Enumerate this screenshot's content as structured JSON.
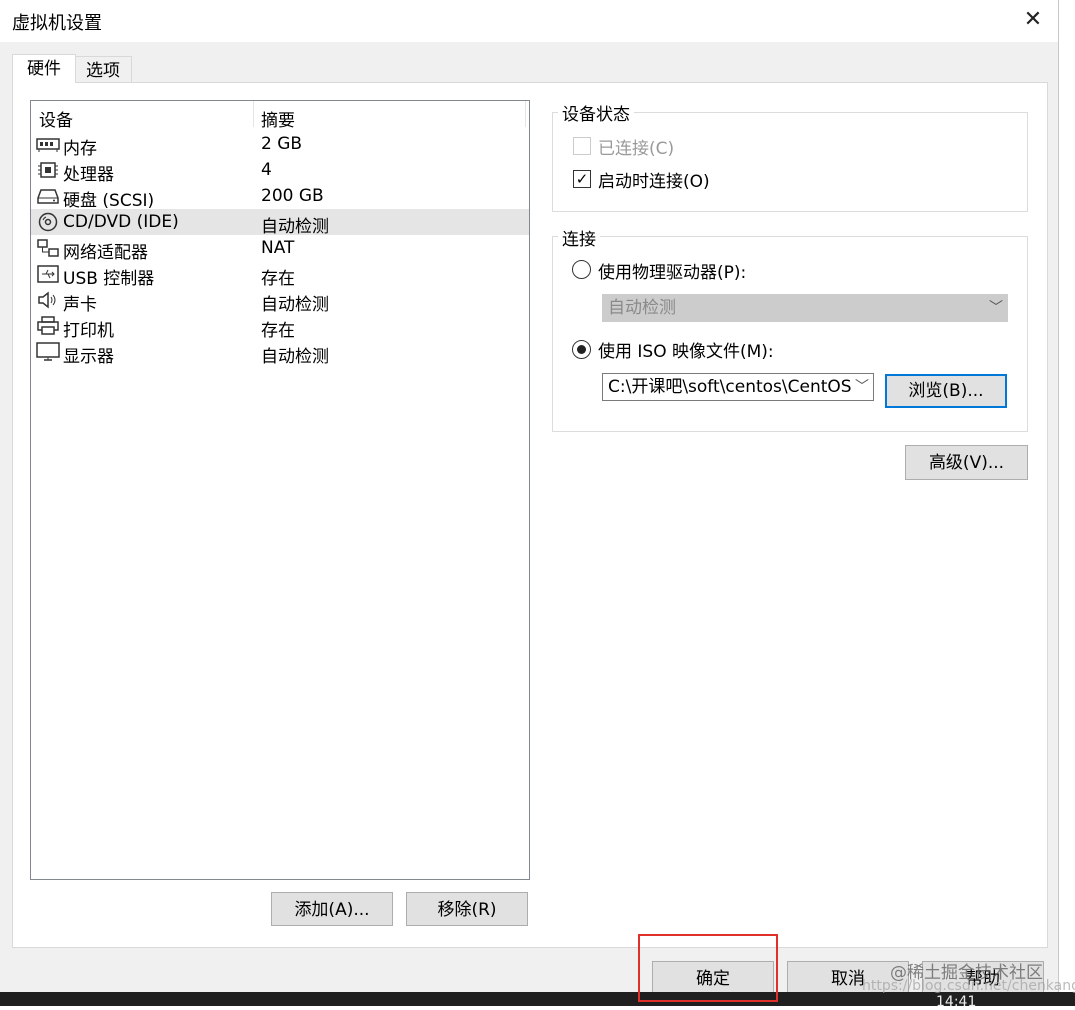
{
  "window": {
    "title": "虚拟机设置",
    "close_glyph": "✕"
  },
  "tabs": [
    {
      "label": "硬件",
      "active": true
    },
    {
      "label": "选项",
      "active": false
    }
  ],
  "device_list": {
    "headers": {
      "device": "设备",
      "summary": "摘要"
    },
    "rows": [
      {
        "icon": "memory-icon",
        "name": "内存",
        "summary": "2 GB"
      },
      {
        "icon": "processor-icon",
        "name": "处理器",
        "summary": "4"
      },
      {
        "icon": "harddisk-icon",
        "name": "硬盘 (SCSI)",
        "summary": "200 GB"
      },
      {
        "icon": "cd-dvd-icon",
        "name": "CD/DVD (IDE)",
        "summary": "自动检测",
        "selected": true
      },
      {
        "icon": "network-adapter-icon",
        "name": "网络适配器",
        "summary": "NAT"
      },
      {
        "icon": "usb-icon",
        "name": "USB 控制器",
        "summary": "存在"
      },
      {
        "icon": "sound-card-icon",
        "name": "声卡",
        "summary": "自动检测"
      },
      {
        "icon": "printer-icon",
        "name": "打印机",
        "summary": "存在"
      },
      {
        "icon": "display-icon",
        "name": "显示器",
        "summary": "自动检测"
      }
    ],
    "add_button": "添加(A)...",
    "remove_button": "移除(R)"
  },
  "device_status": {
    "group_label": "设备状态",
    "connected": {
      "label": "已连接(C)",
      "checked": false,
      "disabled": true
    },
    "connect_at_power_on": {
      "label": "启动时连接(O)",
      "checked": true,
      "check_glyph": "✓"
    }
  },
  "connection": {
    "group_label": "连接",
    "physical_drive": {
      "label": "使用物理驱动器(P):",
      "selected": false,
      "value": "自动检测"
    },
    "iso_image": {
      "label": "使用 ISO 映像文件(M):",
      "selected": true,
      "value": "C:\\开课吧\\soft\\centos\\CentOS",
      "browse_button": "浏览(B)..."
    },
    "advanced_button": "高级(V)..."
  },
  "footer": {
    "ok_button": "确定",
    "cancel_button": "取消",
    "help_button": "帮助"
  },
  "taskbar": {
    "clock": "14:41"
  },
  "overlay": {
    "watermark": "@稀土掘金技术社区",
    "watermark_url": "https://blog.csdn.net/chenkang",
    "highlight_color": "#e0302a"
  },
  "icons": {
    "chevron": "﹀"
  }
}
